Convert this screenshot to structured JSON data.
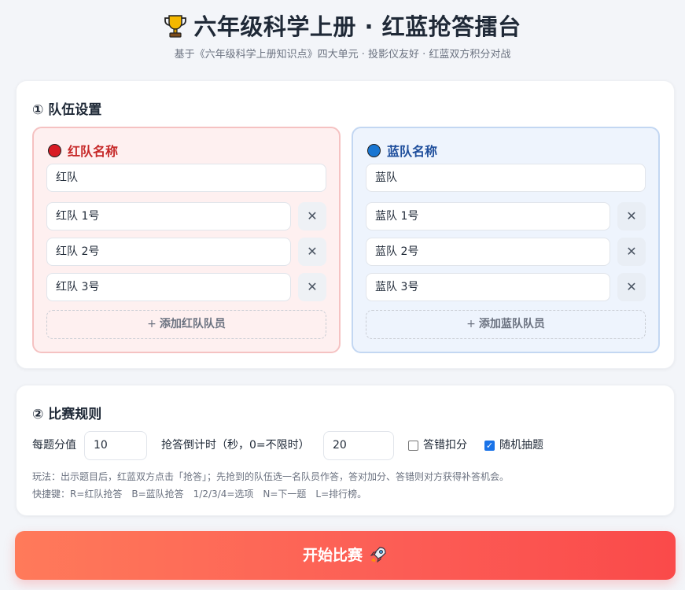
{
  "header": {
    "trophy_icon": "trophy-icon",
    "title": "六年级科学上册 · 红蓝抢答擂台",
    "subtitle": "基于《六年级科学上册知识点》四大单元 · 投影仪友好 · 红蓝双方积分对战"
  },
  "team_setup": {
    "section_title": "① 队伍设置",
    "red": {
      "label": "红队名称",
      "color": "#d81b24",
      "name_value": "红队",
      "members": [
        "红队 1号",
        "红队 2号",
        "红队 3号"
      ],
      "delete_glyph": "✕",
      "add_label": "添加红队队员",
      "add_glyph": "+"
    },
    "blue": {
      "label": "蓝队名称",
      "color": "#1976d2",
      "name_value": "蓝队",
      "members": [
        "蓝队 1号",
        "蓝队 2号",
        "蓝队 3号"
      ],
      "delete_glyph": "✕",
      "add_label": "添加蓝队队员",
      "add_glyph": "+"
    }
  },
  "rules": {
    "section_title": "② 比赛规则",
    "points_label": "每题分值",
    "points_value": "10",
    "timer_label": "抢答倒计时（秒，0=不限时）",
    "timer_value": "20",
    "deduct_label": "答错扣分",
    "deduct_checked": false,
    "random_label": "随机抽题",
    "random_checked": true,
    "hint_play": "玩法：出示题目后，红蓝双方点击「抢答」；先抢到的队伍选一名队员作答，答对加分、答错则对方获得补答机会。",
    "hint_keys": "快捷键：R=红队抢答　B=蓝队抢答　1/2/3/4=选项　N=下一题　L=排行榜。"
  },
  "start_button": {
    "label": "开始比赛",
    "icon": "rocket-icon"
  },
  "colors": {
    "start_gradient_from": "#ff7a5a",
    "start_gradient_to": "#fa4a4a",
    "checkbox_accent": "#1a73e8"
  }
}
